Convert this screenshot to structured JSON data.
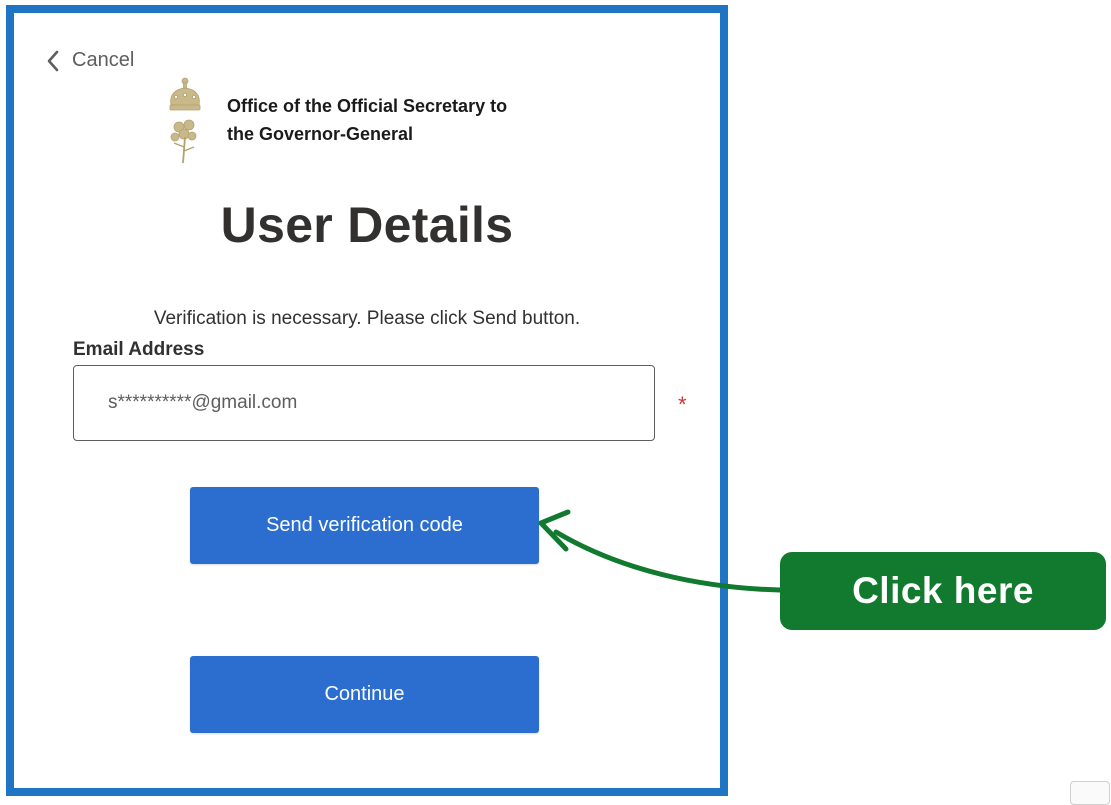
{
  "header": {
    "cancel_label": "Cancel",
    "org_name": "Office of the Official Secretary to\nthe Governor-General"
  },
  "page": {
    "title": "User Details",
    "intro": "Verification is necessary. Please click Send button."
  },
  "form": {
    "email_label": "Email Address",
    "email_value": "s**********@gmail.com",
    "required_marker": "*"
  },
  "buttons": {
    "send_label": "Send verification code",
    "continue_label": "Continue"
  },
  "callout": {
    "label": "Click here"
  },
  "colors": {
    "frame_border": "#1f74c4",
    "button_blue": "#2b6ecf",
    "callout_green": "#127a2e",
    "required_red": "#d13438",
    "crest_gold": "#c9b98a"
  }
}
